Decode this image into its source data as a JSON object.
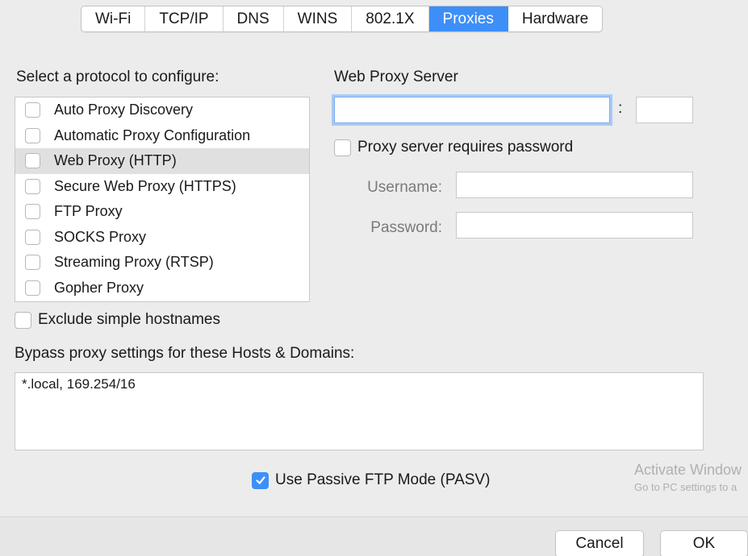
{
  "tabs": [
    {
      "label": "Wi-Fi",
      "active": false
    },
    {
      "label": "TCP/IP",
      "active": false
    },
    {
      "label": "DNS",
      "active": false
    },
    {
      "label": "WINS",
      "active": false
    },
    {
      "label": "802.1X",
      "active": false
    },
    {
      "label": "Proxies",
      "active": true
    },
    {
      "label": "Hardware",
      "active": false
    }
  ],
  "protocols": {
    "title": "Select a protocol to configure:",
    "items": [
      {
        "label": "Auto Proxy Discovery",
        "checked": false,
        "selected": false
      },
      {
        "label": "Automatic Proxy Configuration",
        "checked": false,
        "selected": false
      },
      {
        "label": "Web Proxy (HTTP)",
        "checked": false,
        "selected": true
      },
      {
        "label": "Secure Web Proxy (HTTPS)",
        "checked": false,
        "selected": false
      },
      {
        "label": "FTP Proxy",
        "checked": false,
        "selected": false
      },
      {
        "label": "SOCKS Proxy",
        "checked": false,
        "selected": false
      },
      {
        "label": "Streaming Proxy (RTSP)",
        "checked": false,
        "selected": false
      },
      {
        "label": "Gopher Proxy",
        "checked": false,
        "selected": false
      }
    ]
  },
  "server": {
    "title": "Web Proxy Server",
    "host_value": "",
    "colon": ":",
    "port_value": "",
    "requires_password_label": "Proxy server requires password",
    "requires_password_checked": false,
    "username_label": "Username:",
    "username_value": "",
    "password_label": "Password:",
    "password_value": ""
  },
  "exclude_simple_hostnames": {
    "label": "Exclude simple hostnames",
    "checked": false
  },
  "bypass": {
    "label": "Bypass proxy settings for these Hosts & Domains:",
    "value": "*.local, 169.254/16"
  },
  "passive_ftp": {
    "label": "Use Passive FTP Mode (PASV)",
    "checked": true
  },
  "watermark": {
    "line1": "Activate Window",
    "line2": "Go to PC settings to a"
  },
  "buttons": {
    "cancel": "Cancel",
    "ok": "OK"
  },
  "colors": {
    "accent": "#3d8ff7",
    "selected_row": "#e0e0e0",
    "background": "#ececec"
  }
}
